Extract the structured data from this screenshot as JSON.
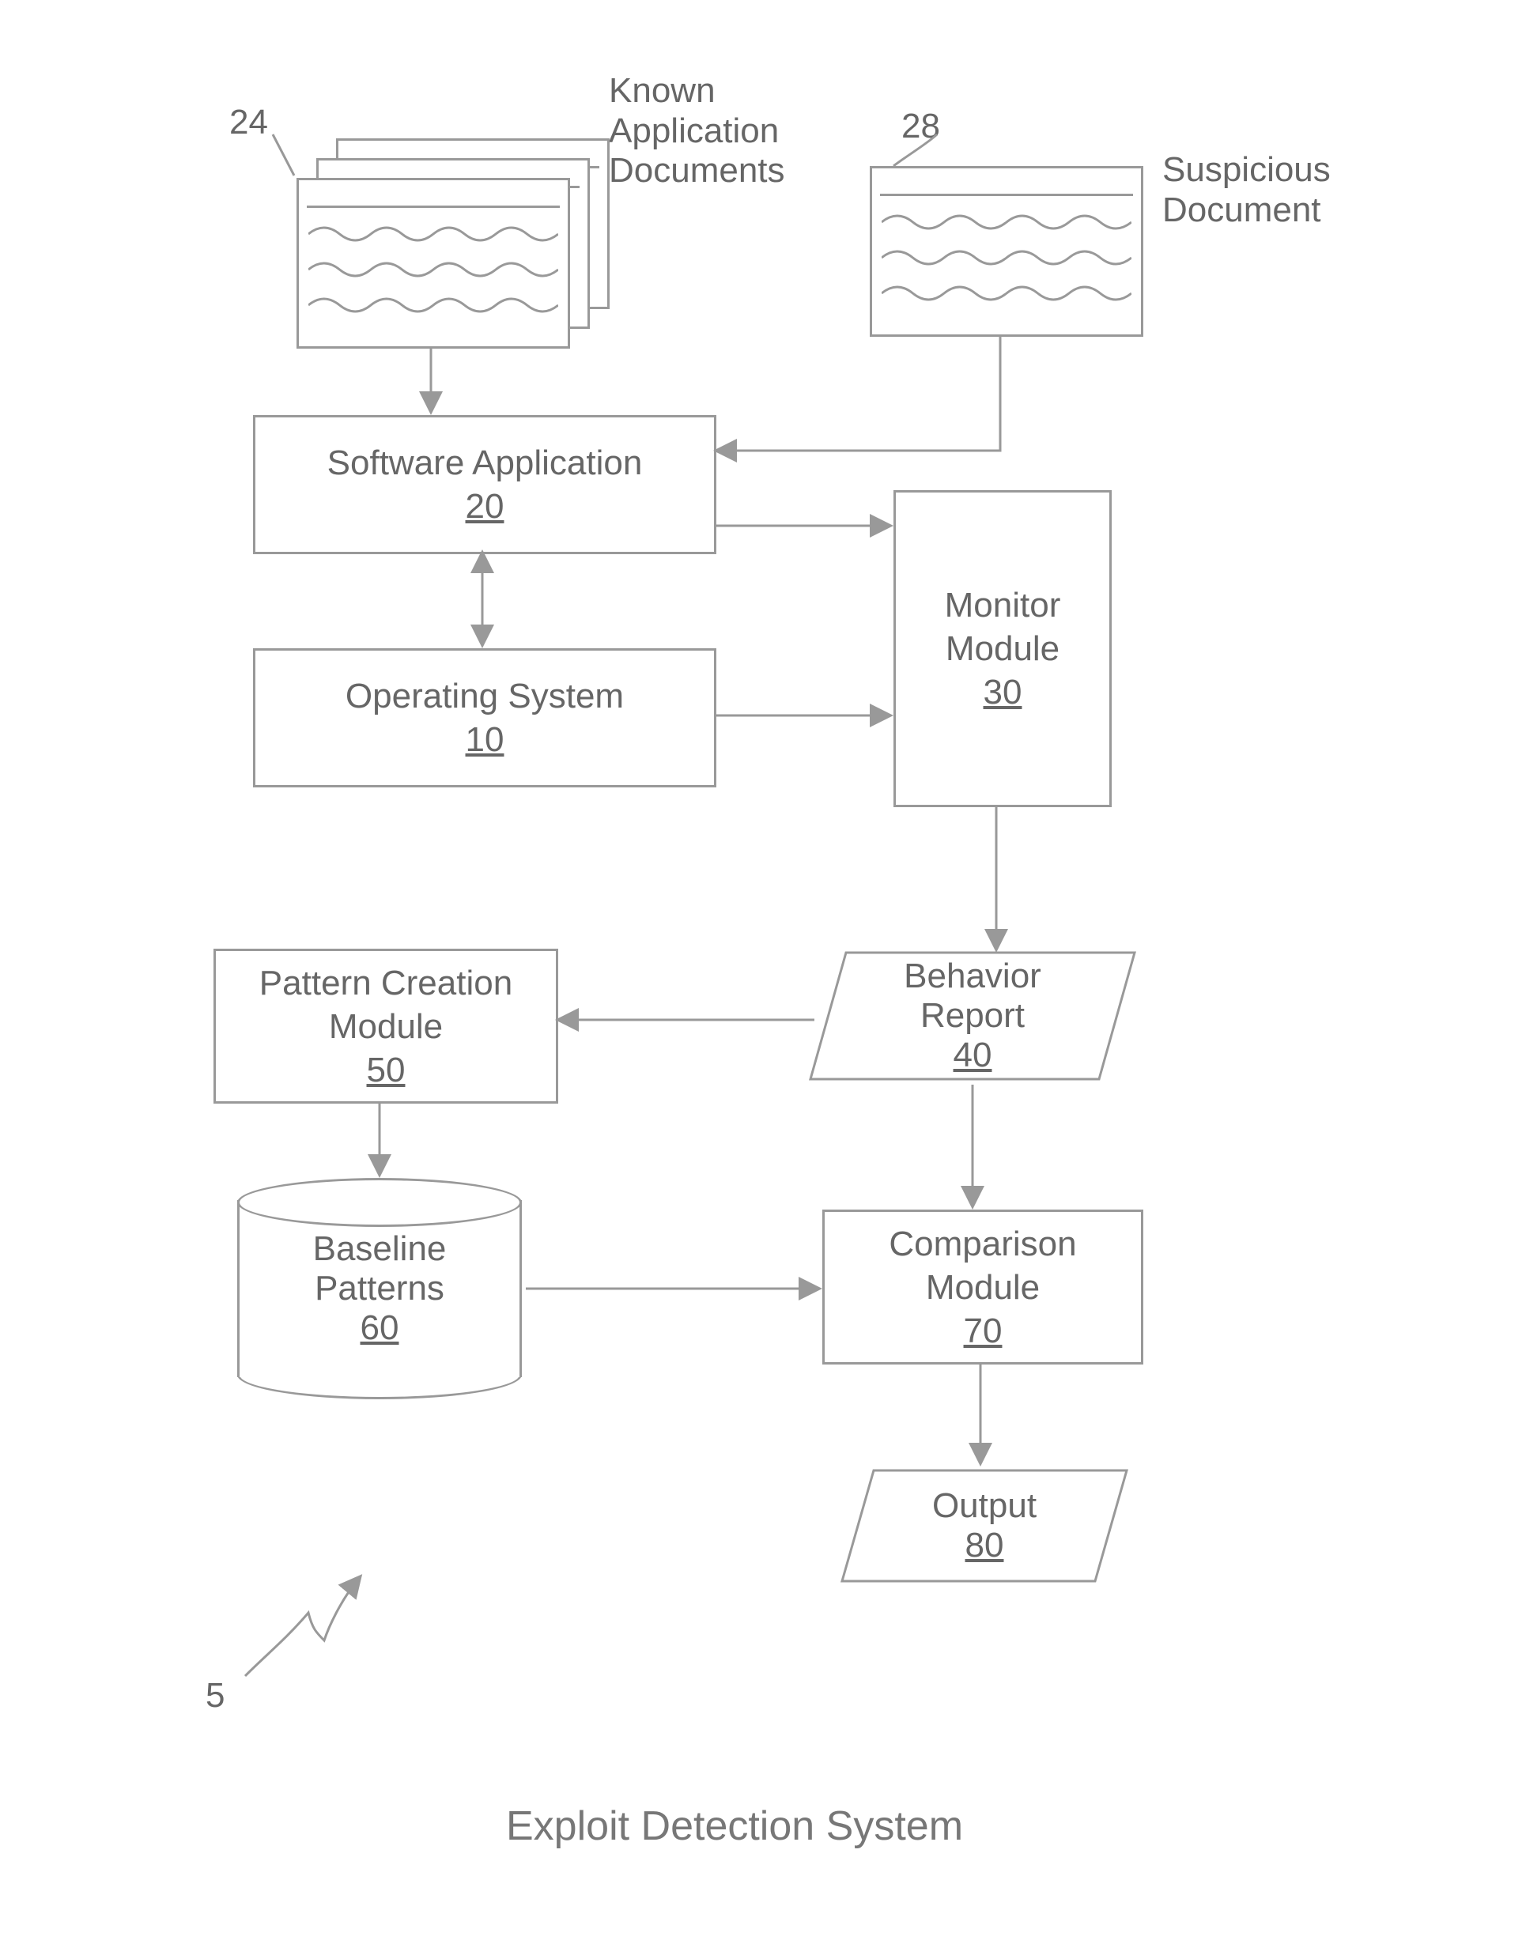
{
  "labels": {
    "known_docs_heading": "Known\nApplication\nDocuments",
    "suspicious_heading": "Suspicious\nDocument",
    "ref_24": "24",
    "ref_28": "28",
    "ref_5": "5"
  },
  "nodes": {
    "software_app": {
      "title": "Software Application",
      "num": "20"
    },
    "operating_system": {
      "title": "Operating System",
      "num": "10"
    },
    "monitor_module": {
      "title": "Monitor\nModule",
      "num": "30"
    },
    "behavior_report": {
      "title": "Behavior\nReport",
      "num": "40"
    },
    "pattern_creation": {
      "title": "Pattern Creation\nModule",
      "num": "50"
    },
    "baseline_patterns": {
      "title": "Baseline\nPatterns",
      "num": "60"
    },
    "comparison_module": {
      "title": "Comparison\nModule",
      "num": "70"
    },
    "output": {
      "title": "Output",
      "num": "80"
    }
  },
  "caption": "Exploit Detection System",
  "chart_data": {
    "type": "diagram",
    "title": "Exploit Detection System",
    "nodes": [
      {
        "id": "24",
        "label": "Known Application Documents",
        "shape": "document-stack"
      },
      {
        "id": "28",
        "label": "Suspicious Document",
        "shape": "document"
      },
      {
        "id": "20",
        "label": "Software Application",
        "shape": "rectangle"
      },
      {
        "id": "10",
        "label": "Operating System",
        "shape": "rectangle"
      },
      {
        "id": "30",
        "label": "Monitor Module",
        "shape": "rectangle"
      },
      {
        "id": "40",
        "label": "Behavior Report",
        "shape": "parallelogram"
      },
      {
        "id": "50",
        "label": "Pattern Creation Module",
        "shape": "rectangle"
      },
      {
        "id": "60",
        "label": "Baseline Patterns",
        "shape": "cylinder"
      },
      {
        "id": "70",
        "label": "Comparison Module",
        "shape": "rectangle"
      },
      {
        "id": "80",
        "label": "Output",
        "shape": "parallelogram"
      },
      {
        "id": "5",
        "label": "System reference",
        "shape": "reference-arrow"
      }
    ],
    "edges": [
      {
        "from": "24",
        "to": "20",
        "dir": "forward"
      },
      {
        "from": "28",
        "to": "20",
        "dir": "forward"
      },
      {
        "from": "20",
        "to": "10",
        "dir": "both"
      },
      {
        "from": "20",
        "to": "30",
        "dir": "forward"
      },
      {
        "from": "10",
        "to": "30",
        "dir": "forward"
      },
      {
        "from": "30",
        "to": "40",
        "dir": "forward"
      },
      {
        "from": "40",
        "to": "50",
        "dir": "forward"
      },
      {
        "from": "40",
        "to": "70",
        "dir": "forward"
      },
      {
        "from": "50",
        "to": "60",
        "dir": "forward"
      },
      {
        "from": "60",
        "to": "70",
        "dir": "forward"
      },
      {
        "from": "70",
        "to": "80",
        "dir": "forward"
      }
    ]
  }
}
